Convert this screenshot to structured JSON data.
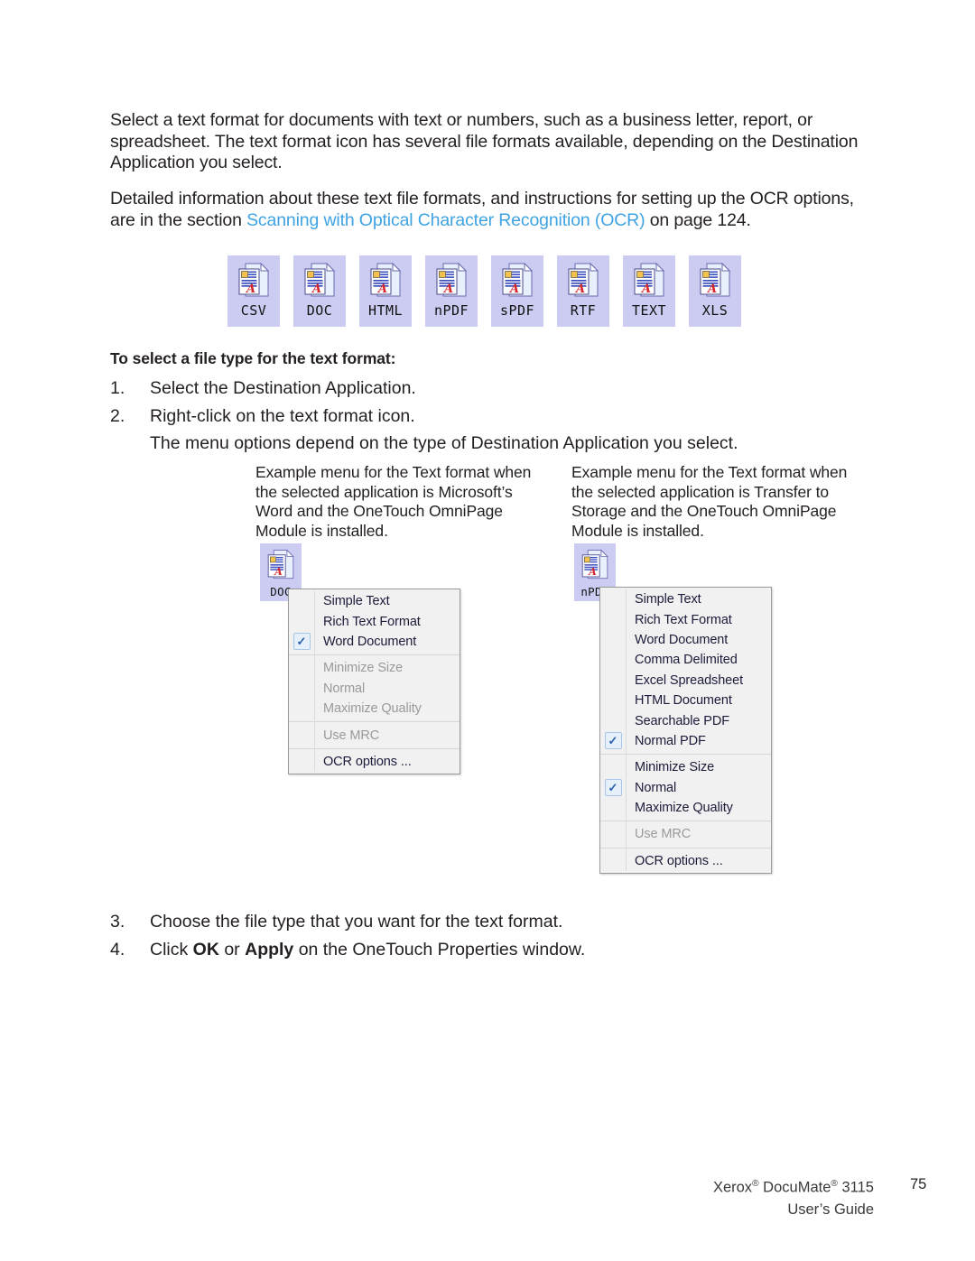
{
  "paragraphs": {
    "intro": "Select a text format for documents with text or numbers, such as a business letter, report, or spreadsheet. The text format icon has several file formats available, depending on the Destination Application you select.",
    "detail_before": "Detailed information about these text file formats, and instructions for setting up the OCR options, are in the section ",
    "detail_link": "Scanning with Optical Character Recognition (OCR)",
    "detail_after": " on page 124."
  },
  "icon_strip": {
    "items": [
      {
        "label": "CSV"
      },
      {
        "label": "DOC"
      },
      {
        "label": "HTML"
      },
      {
        "label": "nPDF"
      },
      {
        "label": "sPDF"
      },
      {
        "label": "RTF"
      },
      {
        "label": "TEXT"
      },
      {
        "label": "XLS"
      }
    ]
  },
  "heading_select": "To select a file type for the text format:",
  "list_top": {
    "item1_num": "1.",
    "item1_text": "Select the Destination Application.",
    "item2_num": "2.",
    "item2_text": "Right-click on the text format icon.",
    "item2_sub": "The menu options depend on the type of Destination Application you select."
  },
  "captions": {
    "left": "Example menu for the Text format when the selected application is Microsoft’s Word and the OneTouch OmniPage Module is installed.",
    "right": "Example menu for the Text format when the selected application is Transfer to Storage and the OneTouch OmniPage Module is installed."
  },
  "menu_left": {
    "source_icon_label": "DOC",
    "items": [
      {
        "label": "Simple Text",
        "checked": false,
        "disabled": false
      },
      {
        "label": "Rich Text Format",
        "checked": false,
        "disabled": false
      },
      {
        "label": "Word Document",
        "checked": true,
        "disabled": false
      },
      {
        "separator": true
      },
      {
        "label": "Minimize Size",
        "checked": false,
        "disabled": true
      },
      {
        "label": "Normal",
        "checked": false,
        "disabled": true
      },
      {
        "label": "Maximize Quality",
        "checked": false,
        "disabled": true
      },
      {
        "separator": true
      },
      {
        "label": "Use MRC",
        "checked": false,
        "disabled": true
      },
      {
        "separator": true
      },
      {
        "label": "OCR options ...",
        "checked": false,
        "disabled": false
      }
    ]
  },
  "menu_right": {
    "source_icon_label": "nPDF",
    "items": [
      {
        "label": "Simple Text",
        "checked": false,
        "disabled": false
      },
      {
        "label": "Rich Text Format",
        "checked": false,
        "disabled": false
      },
      {
        "label": "Word Document",
        "checked": false,
        "disabled": false
      },
      {
        "label": "Comma Delimited",
        "checked": false,
        "disabled": false
      },
      {
        "label": "Excel Spreadsheet",
        "checked": false,
        "disabled": false
      },
      {
        "label": "HTML Document",
        "checked": false,
        "disabled": false
      },
      {
        "label": "Searchable PDF",
        "checked": false,
        "disabled": false
      },
      {
        "label": "Normal PDF",
        "checked": true,
        "disabled": false
      },
      {
        "separator": true
      },
      {
        "label": "Minimize Size",
        "checked": false,
        "disabled": false
      },
      {
        "label": "Normal",
        "checked": true,
        "disabled": false
      },
      {
        "label": "Maximize Quality",
        "checked": false,
        "disabled": false
      },
      {
        "separator": true
      },
      {
        "label": "Use MRC",
        "checked": false,
        "disabled": true
      },
      {
        "separator": true
      },
      {
        "label": "OCR options ...",
        "checked": false,
        "disabled": false
      }
    ]
  },
  "list_bottom": {
    "item3_num": "3.",
    "item3_text": "Choose the file type that you want for the text format.",
    "item4_num": "4.",
    "item4_click": "Click ",
    "item4_ok": "OK",
    "item4_or": " or ",
    "item4_apply": "Apply",
    "item4_rest": " on the OneTouch Properties window."
  },
  "footer": {
    "product": "Xerox",
    "product_sup": "®",
    "product2": " DocuMate",
    "product2_sup": "®",
    "product3": " 3115",
    "guide": "User’s Guide",
    "page_number": "75"
  },
  "colors": {
    "link": "#3fa3e3",
    "icon_tile_bg": "#ccccf2",
    "menu_bg": "#f1f1f1",
    "check_blue": "#2b5fad"
  },
  "check_glyph": "✓"
}
